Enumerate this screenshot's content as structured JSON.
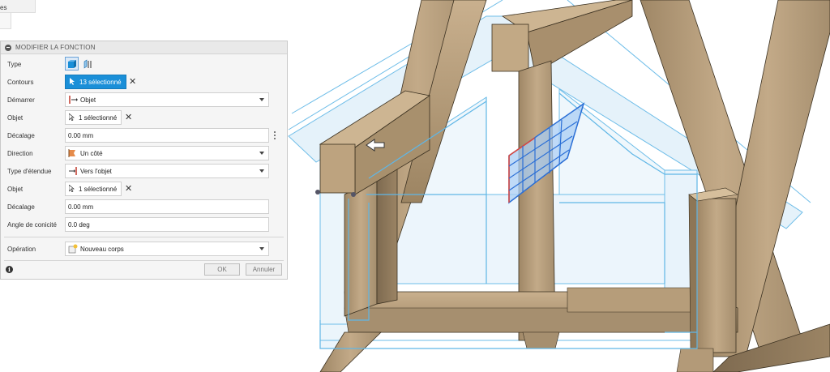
{
  "top_stub": {
    "label": "es"
  },
  "panel": {
    "title": "MODIFIER LA FONCTION",
    "rows": {
      "type": {
        "label": "Type",
        "icons": [
          "extrude-solid-icon",
          "extrude-surface-icon"
        ]
      },
      "contours": {
        "label": "Contours",
        "value": "13 sélectionné"
      },
      "demarrer": {
        "label": "Démarrer",
        "value": "Objet"
      },
      "objet1": {
        "label": "Objet",
        "value": "1 sélectionné"
      },
      "decalage1": {
        "label": "Décalage",
        "value": "0.00 mm"
      },
      "direction": {
        "label": "Direction",
        "value": "Un côté"
      },
      "type_etendue": {
        "label": "Type d'étendue",
        "value": "Vers l'objet"
      },
      "objet2": {
        "label": "Objet",
        "value": "1 sélectionné"
      },
      "decalage2": {
        "label": "Décalage",
        "value": "0.00 mm"
      },
      "angle_conicite": {
        "label": "Angle de conicité",
        "value": "0.0 deg"
      },
      "operation": {
        "label": "Opération",
        "value": "Nouveau corps"
      }
    },
    "footer": {
      "info": "i",
      "ok": "OK",
      "cancel": "Annuler"
    }
  },
  "colors": {
    "accent": "#1a8fd8",
    "wood": "#b49a78",
    "sketch_lines": "#5fb6e6",
    "selection_red": "#e0463a",
    "selection_blue": "#2b6fd6"
  }
}
